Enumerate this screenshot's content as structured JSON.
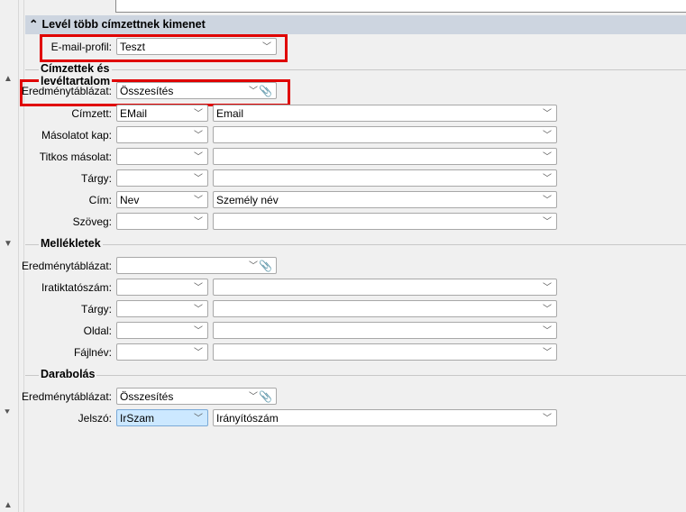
{
  "section_title": "Levél több címzettnek kimenet",
  "email_profile": {
    "label": "E-mail-profil:",
    "value": "Teszt"
  },
  "recipients": {
    "title": "Címzettek és levéltartalom",
    "result_table": {
      "label": "Eredménytáblázat:",
      "value": "Összesítés"
    },
    "rows": [
      {
        "label": "Címzett:",
        "field": "EMail",
        "display": "Email"
      },
      {
        "label": "Másolatot kap:",
        "field": "",
        "display": ""
      },
      {
        "label": "Titkos másolat:",
        "field": "",
        "display": ""
      },
      {
        "label": "Tárgy:",
        "field": "",
        "display": ""
      },
      {
        "label": "Cím:",
        "field": "Nev",
        "display": "Személy név"
      },
      {
        "label": "Szöveg:",
        "field": "",
        "display": ""
      }
    ]
  },
  "attachments": {
    "title": "Mellékletek",
    "result_table": {
      "label": "Eredménytáblázat:",
      "value": ""
    },
    "rows": [
      {
        "label": "Iratiktatószám:",
        "field": "",
        "display": ""
      },
      {
        "label": "Tárgy:",
        "field": "",
        "display": ""
      },
      {
        "label": "Oldal:",
        "field": "",
        "display": ""
      },
      {
        "label": "Fájlnév:",
        "field": "",
        "display": ""
      }
    ]
  },
  "splitting": {
    "title": "Darabolás",
    "result_table": {
      "label": "Eredménytáblázat:",
      "value": "Összesítés"
    },
    "rows": [
      {
        "label": "Jelszó:",
        "field": "IrSzam",
        "display": "Irányítószám"
      }
    ]
  },
  "highlight_color": "#e00000"
}
